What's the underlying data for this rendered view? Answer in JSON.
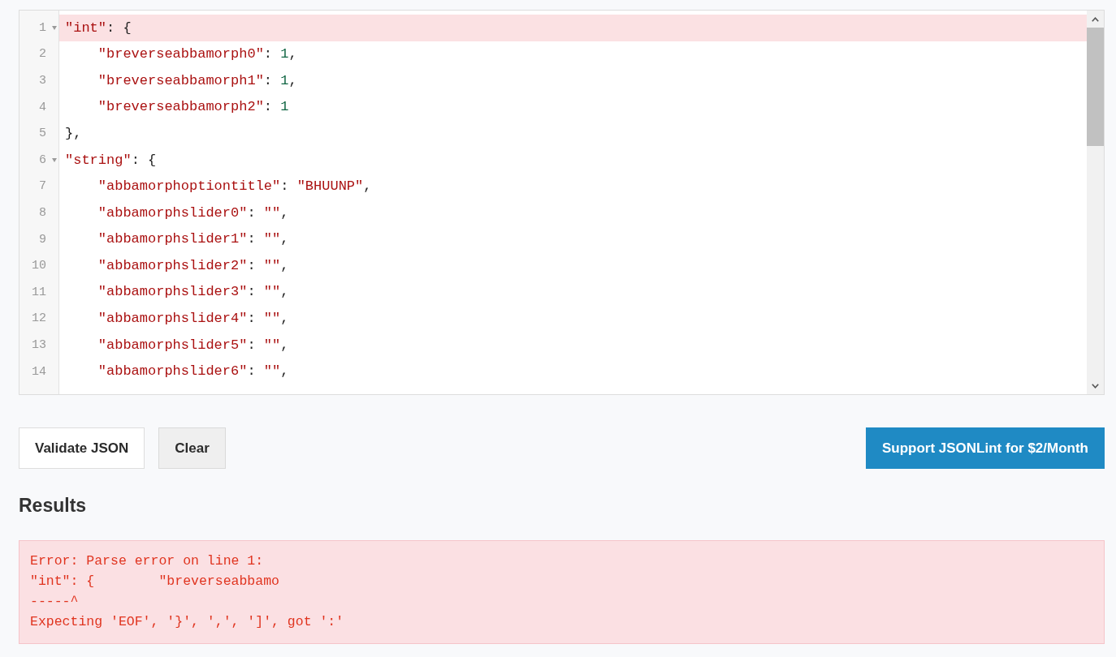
{
  "editor": {
    "lines": [
      {
        "number": "1",
        "expanded": true,
        "highlighted": true,
        "tokens": [
          {
            "kind": "key",
            "text": "\"int\""
          },
          {
            "kind": "punct",
            "text": ": {"
          }
        ],
        "children": [
          {
            "number": "2",
            "highlighted": false,
            "tokens": [
              {
                "kind": "key",
                "text": "\"breverseabbamorph0\""
              },
              {
                "kind": "punct",
                "text": ": "
              },
              {
                "kind": "number",
                "text": "1"
              },
              {
                "kind": "punct",
                "text": ","
              }
            ]
          },
          {
            "number": "3",
            "highlighted": false,
            "tokens": [
              {
                "kind": "key",
                "text": "\"breverseabbamorph1\""
              },
              {
                "kind": "punct",
                "text": ": "
              },
              {
                "kind": "number",
                "text": "1"
              },
              {
                "kind": "punct",
                "text": ","
              }
            ]
          },
          {
            "number": "4",
            "highlighted": false,
            "tokens": [
              {
                "kind": "key",
                "text": "\"breverseabbamorph2\""
              },
              {
                "kind": "punct",
                "text": ": "
              },
              {
                "kind": "number",
                "text": "1"
              }
            ]
          }
        ]
      },
      {
        "number": "5",
        "highlighted": false,
        "tokens": [
          {
            "kind": "punct",
            "text": "},"
          }
        ]
      },
      {
        "number": "6",
        "expanded": true,
        "highlighted": false,
        "tokens": [
          {
            "kind": "key",
            "text": "\"string\""
          },
          {
            "kind": "punct",
            "text": ": {"
          }
        ],
        "children": [
          {
            "number": "7",
            "highlighted": false,
            "tokens": [
              {
                "kind": "key",
                "text": "\"abbamorphoptiontitle\""
              },
              {
                "kind": "punct",
                "text": ": "
              },
              {
                "kind": "string",
                "text": "\"BHUUNP\""
              },
              {
                "kind": "punct",
                "text": ","
              }
            ]
          },
          {
            "number": "8",
            "highlighted": false,
            "tokens": [
              {
                "kind": "key",
                "text": "\"abbamorphslider0\""
              },
              {
                "kind": "punct",
                "text": ": "
              },
              {
                "kind": "string",
                "text": "\"\""
              },
              {
                "kind": "punct",
                "text": ","
              }
            ]
          },
          {
            "number": "9",
            "highlighted": false,
            "tokens": [
              {
                "kind": "key",
                "text": "\"abbamorphslider1\""
              },
              {
                "kind": "punct",
                "text": ": "
              },
              {
                "kind": "string",
                "text": "\"\""
              },
              {
                "kind": "punct",
                "text": ","
              }
            ]
          },
          {
            "number": "10",
            "highlighted": false,
            "tokens": [
              {
                "kind": "key",
                "text": "\"abbamorphslider2\""
              },
              {
                "kind": "punct",
                "text": ": "
              },
              {
                "kind": "string",
                "text": "\"\""
              },
              {
                "kind": "punct",
                "text": ","
              }
            ]
          },
          {
            "number": "11",
            "highlighted": false,
            "tokens": [
              {
                "kind": "key",
                "text": "\"abbamorphslider3\""
              },
              {
                "kind": "punct",
                "text": ": "
              },
              {
                "kind": "string",
                "text": "\"\""
              },
              {
                "kind": "punct",
                "text": ","
              }
            ]
          },
          {
            "number": "12",
            "highlighted": false,
            "tokens": [
              {
                "kind": "key",
                "text": "\"abbamorphslider4\""
              },
              {
                "kind": "punct",
                "text": ": "
              },
              {
                "kind": "string",
                "text": "\"\""
              },
              {
                "kind": "punct",
                "text": ","
              }
            ]
          },
          {
            "number": "13",
            "highlighted": false,
            "tokens": [
              {
                "kind": "key",
                "text": "\"abbamorphslider5\""
              },
              {
                "kind": "punct",
                "text": ": "
              },
              {
                "kind": "string",
                "text": "\"\""
              },
              {
                "kind": "punct",
                "text": ","
              }
            ]
          },
          {
            "number": "14",
            "highlighted": false,
            "tokens": [
              {
                "kind": "key",
                "text": "\"abbamorphslider6\""
              },
              {
                "kind": "punct",
                "text": ": "
              },
              {
                "kind": "string",
                "text": "\"\""
              },
              {
                "kind": "punct",
                "text": ","
              }
            ]
          }
        ]
      }
    ]
  },
  "buttons": [
    {
      "label": "Validate JSON",
      "kind": "outline"
    },
    {
      "label": "Clear",
      "kind": "muted"
    },
    {
      "label": "Support JSONLint for $2/Month",
      "kind": "primary"
    }
  ],
  "results": {
    "heading": "Results",
    "error_lines": [
      "Error: Parse error on line 1:",
      "\"int\": {        \"breverseabbamo",
      "-----^",
      "Expecting 'EOF', '}', ',', ']', got ':'"
    ]
  }
}
